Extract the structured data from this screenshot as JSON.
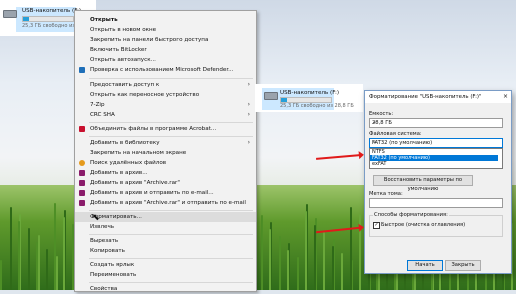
{
  "drive": {
    "name": "USB-накопитель (F:)",
    "space": "25,3 ГБ свободно из 28,8 ГБ",
    "name_right": "USB-накопитель (F:)",
    "space_right": "25,3 ГБ свободно из 28,8 ГБ",
    "used_fraction": 0.12
  },
  "context_menu": {
    "items": [
      {
        "label": "Открыть",
        "bold": true
      },
      {
        "label": "Открыть в новом окне"
      },
      {
        "label": "Закрепить на панели быстрого доступа"
      },
      {
        "label": "Включить BitLocker"
      },
      {
        "label": "Открыть автозапуск..."
      },
      {
        "label": "Проверка с использованием Microsoft Defender..."
      },
      {
        "label": "Предоставить доступ к"
      },
      {
        "label": "Открыть как переносное устройство"
      },
      {
        "label": "7-Zip"
      },
      {
        "label": "CRC SHA"
      },
      {
        "label": "Объединить файлы в программе Acrobat..."
      },
      {
        "label": "Добавить в библиотеку"
      },
      {
        "label": "Закрепить на начальном экране"
      },
      {
        "label": "Поиск удалённых файлов"
      },
      {
        "label": "Добавить в архив..."
      },
      {
        "label": "Добавить в архив \"Archive.rar\""
      },
      {
        "label": "Добавить в архив и отправить по e-mail..."
      },
      {
        "label": "Добавить в архив \"Archive.rar\" и отправить по e-mail"
      },
      {
        "label": "Форматировать..."
      },
      {
        "label": "Извлечь"
      },
      {
        "label": "Вырезать"
      },
      {
        "label": "Копировать"
      },
      {
        "label": "Создать ярлык"
      },
      {
        "label": "Переименовать"
      },
      {
        "label": "Свойства"
      }
    ]
  },
  "dialog": {
    "title": "Форматирование \"USB-накопитель (F:)\"",
    "close": "×",
    "capacity_label": "Емкость:",
    "capacity_value": "28,8 ГБ",
    "fs_label": "Файловая система:",
    "fs_value": "FAT32 (по умолчанию)",
    "fs_options": [
      "NTFS",
      "FAT32 (по умолчанию)",
      "exFAT"
    ],
    "restore_button": "Восстановить параметры по умолчанию",
    "volume_label": "Метка тома:",
    "volume_value": "",
    "format_options_label": "Способы форматирования:",
    "quick_label": "Быстрое (очистка оглавления)",
    "start_button": "Начать",
    "close_button": "Закрыть"
  },
  "colors": {
    "selection": "#cce8ff",
    "dropdown_highlight": "#0078d7",
    "arrow": "#e01a1a"
  }
}
